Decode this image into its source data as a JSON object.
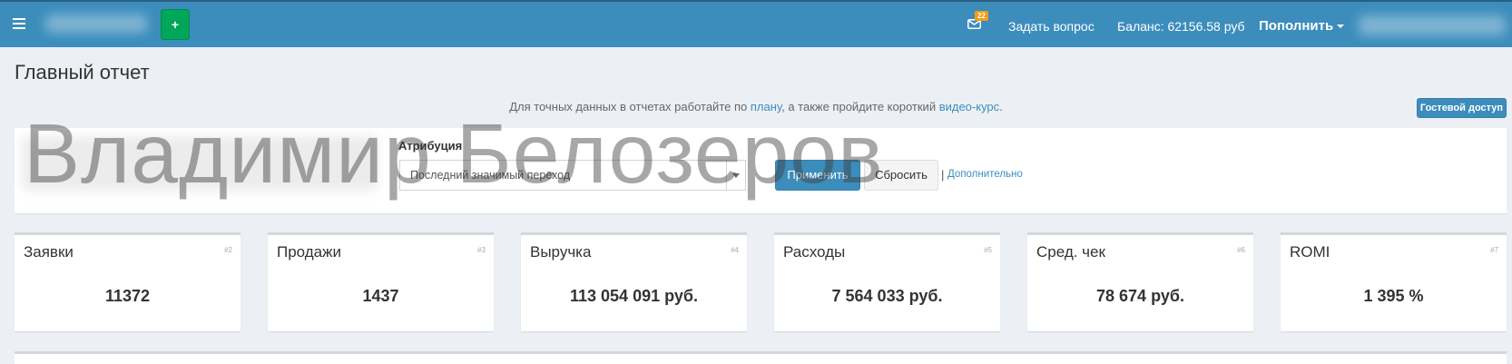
{
  "header": {
    "badge_count": "22",
    "ask_label": "Задать вопрос",
    "balance_label": "Баланс: 62156.58 руб",
    "topup_label": "Пополнить",
    "plus_label": "+"
  },
  "page": {
    "title": "Главный отчет",
    "info_before": "Для точных данных в отчетах работайте по ",
    "info_link1": "плану",
    "info_middle": ", а также пройдите короткий ",
    "info_link2": "видео-курс",
    "info_after": ".",
    "guest_label": "Гостевой доступ"
  },
  "filters": {
    "attribution_label": "Атрибуция",
    "attribution_value": "Последний значимый переход",
    "apply_label": "Применить",
    "reset_label": "Сбросить",
    "separator": "|",
    "more_label": "Дополнительно"
  },
  "watermark": "Владимир Белозеров",
  "cards": [
    {
      "title": "Заявки",
      "num": "#2",
      "value": "11372"
    },
    {
      "title": "Продажи",
      "num": "#3",
      "value": "1437"
    },
    {
      "title": "Выручка",
      "num": "#4",
      "value": "113 054 091 руб."
    },
    {
      "title": "Расходы",
      "num": "#5",
      "value": "7 564 033 руб."
    },
    {
      "title": "Сред. чек",
      "num": "#6",
      "value": "78 674 руб."
    },
    {
      "title": "ROMI",
      "num": "#7",
      "value": "1 395 %"
    }
  ]
}
